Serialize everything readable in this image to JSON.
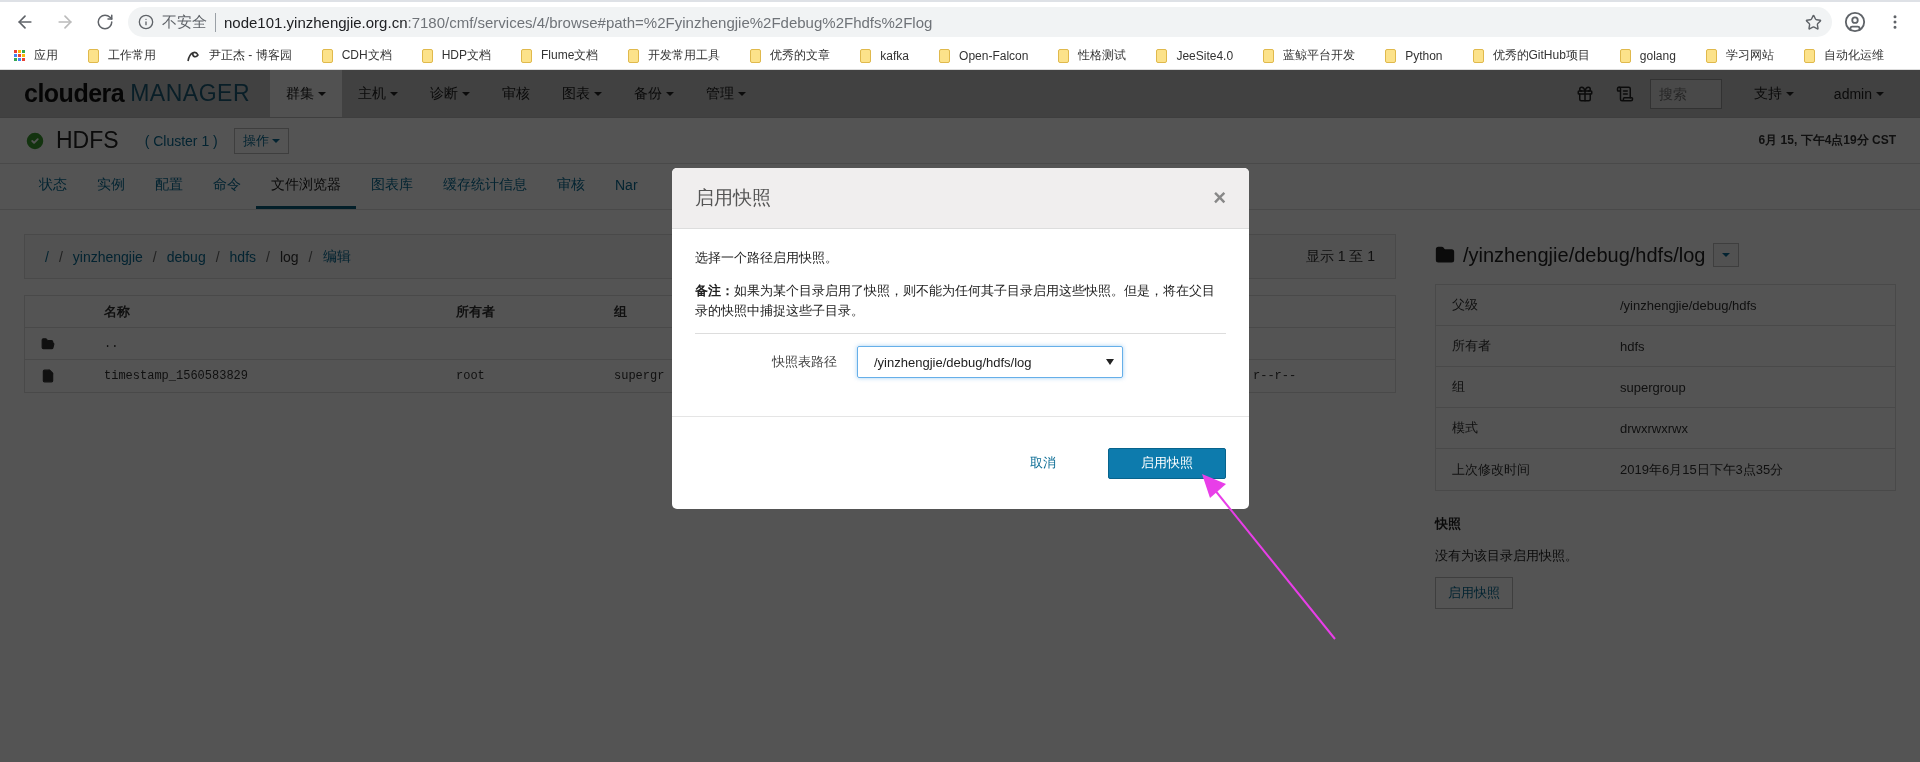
{
  "browser": {
    "security": "不安全",
    "host": "node101.yinzhengjie.org.cn",
    "path": ":7180/cmf/services/4/browse#path=%2Fyinzhengjie%2Fdebug%2Fhdfs%2Flog"
  },
  "bookmarks": [
    {
      "label": "应用",
      "kind": "apps"
    },
    {
      "label": "工作常用",
      "kind": "folder"
    },
    {
      "label": "尹正杰 - 博客园",
      "kind": "site"
    },
    {
      "label": "CDH文档",
      "kind": "folder"
    },
    {
      "label": "HDP文档",
      "kind": "folder"
    },
    {
      "label": "Flume文档",
      "kind": "folder"
    },
    {
      "label": "开发常用工具",
      "kind": "folder"
    },
    {
      "label": "优秀的文章",
      "kind": "folder"
    },
    {
      "label": "kafka",
      "kind": "folder"
    },
    {
      "label": "Open-Falcon",
      "kind": "folder"
    },
    {
      "label": "性格测试",
      "kind": "folder"
    },
    {
      "label": "JeeSite4.0",
      "kind": "folder"
    },
    {
      "label": "蓝鲸平台开发",
      "kind": "folder"
    },
    {
      "label": "Python",
      "kind": "folder"
    },
    {
      "label": "优秀的GitHub项目",
      "kind": "folder"
    },
    {
      "label": "golang",
      "kind": "folder"
    },
    {
      "label": "学习网站",
      "kind": "folder"
    },
    {
      "label": "自动化运维",
      "kind": "folder"
    }
  ],
  "nav": {
    "brand": "cloudera",
    "product": "MANAGER",
    "search_placeholder": "搜索",
    "menus": [
      {
        "label": "群集",
        "selected": true,
        "dropdown": true
      },
      {
        "label": "主机",
        "selected": false,
        "dropdown": true
      },
      {
        "label": "诊断",
        "selected": false,
        "dropdown": true
      },
      {
        "label": "审核",
        "selected": false,
        "dropdown": false
      },
      {
        "label": "图表",
        "selected": false,
        "dropdown": true
      },
      {
        "label": "备份",
        "selected": false,
        "dropdown": true
      },
      {
        "label": "管理",
        "selected": false,
        "dropdown": true
      }
    ],
    "right_menus": [
      "支持",
      "admin"
    ]
  },
  "service": {
    "healthy": true,
    "name": "HDFS",
    "cluster": "( Cluster 1 )",
    "actions": "操作",
    "time": "6月 15, 下午4点19分 CST"
  },
  "tabs": [
    {
      "label": "状态",
      "selected": false
    },
    {
      "label": "实例",
      "selected": false
    },
    {
      "label": "配置",
      "selected": false
    },
    {
      "label": "命令",
      "selected": false
    },
    {
      "label": "文件浏览器",
      "selected": true
    },
    {
      "label": "图表库",
      "selected": false
    },
    {
      "label": "缓存统计信息",
      "selected": false
    },
    {
      "label": "审核",
      "selected": false
    },
    {
      "label": "Nar",
      "selected": false
    }
  ],
  "breadcrumb": {
    "separator": "/",
    "items": [
      {
        "label": "/",
        "kind": "link"
      },
      {
        "label": "yinzhengjie",
        "kind": "link"
      },
      {
        "label": "debug",
        "kind": "link"
      },
      {
        "label": "hdfs",
        "kind": "link"
      },
      {
        "label": "log",
        "kind": "current"
      },
      {
        "label": "编辑",
        "kind": "link"
      }
    ],
    "count": "显示 1 至 1"
  },
  "file_table": {
    "columns": [
      "名称",
      "所有者",
      "组"
    ],
    "rows": [
      {
        "kind": "folder",
        "name": ".."
      },
      {
        "kind": "file",
        "name": "timestamp_1560583829",
        "owner": "root",
        "group": "supergr",
        "permissions": "r--r--"
      }
    ]
  },
  "details": {
    "path": "/yinzhengjie/debug/hdfs/log",
    "properties": [
      {
        "label": "父级",
        "value": "/yinzhengjie/debug/hdfs"
      },
      {
        "label": "所有者",
        "value": "hdfs"
      },
      {
        "label": "组",
        "value": "supergroup"
      },
      {
        "label": "模式",
        "value": "drwxrwxrwx"
      },
      {
        "label": "上次修改时间",
        "value": "2019年6月15日下午3点35分"
      }
    ],
    "snapshots_title": "快照",
    "snapshots_note": "没有为该目录启用快照。",
    "enable_button": "启用快照"
  },
  "dialog": {
    "title": "启用快照",
    "close": "×",
    "intro": "选择一个路径启用快照。",
    "note": "**备注：**如果为某个目录启用了快照，则不能为任何其子目录启用这些快照。但是，将在父目录的快照中捕捉这些子目录。",
    "field_label": "快照表路径",
    "path_value": "/yinzhengjie/debug/hdfs/log",
    "cancel": "取消",
    "confirm": "启用快照"
  }
}
